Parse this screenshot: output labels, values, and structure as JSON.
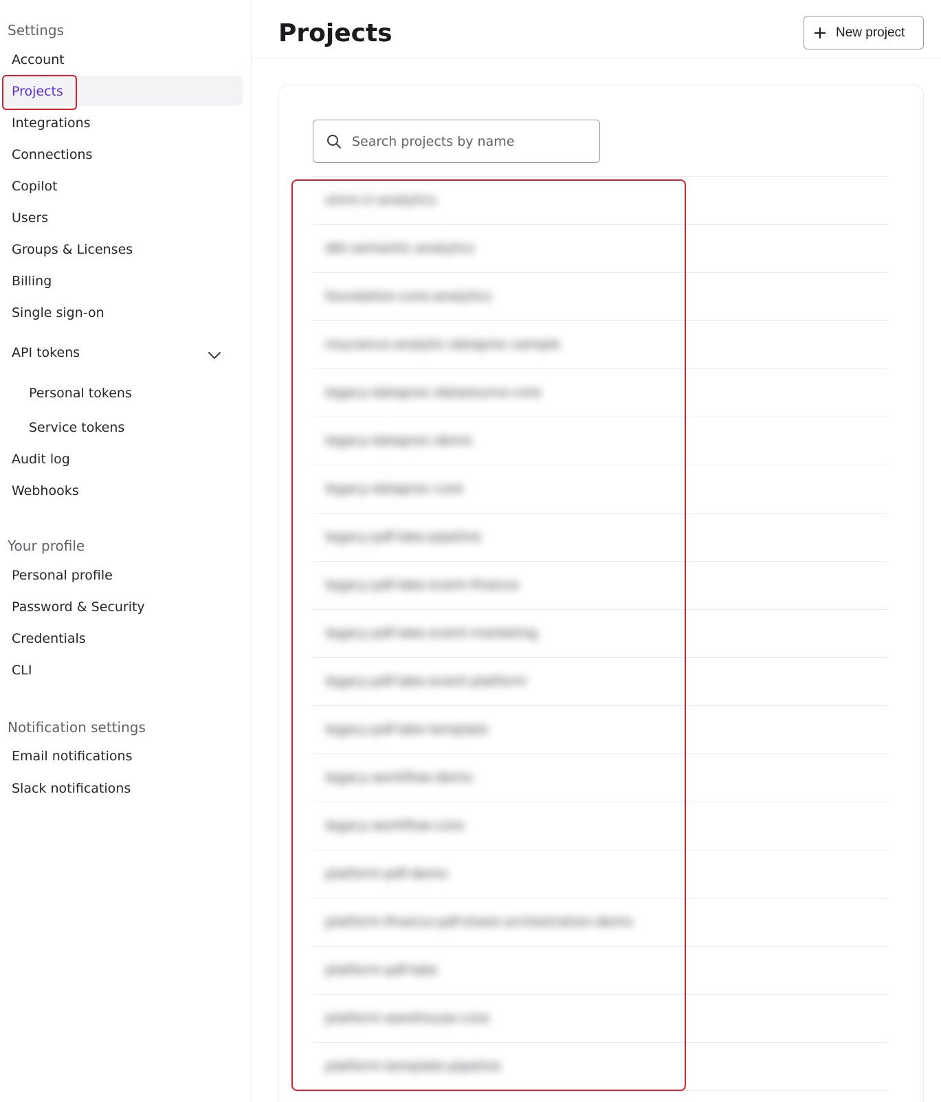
{
  "sidebar": {
    "settings_title": "Settings",
    "items": [
      {
        "label": "Account"
      },
      {
        "label": "Projects"
      },
      {
        "label": "Integrations"
      },
      {
        "label": "Connections"
      },
      {
        "label": "Copilot"
      },
      {
        "label": "Users"
      },
      {
        "label": "Groups & Licenses"
      },
      {
        "label": "Billing"
      },
      {
        "label": "Single sign-on"
      },
      {
        "label": "API tokens"
      },
      {
        "label": "Personal tokens"
      },
      {
        "label": "Service tokens"
      },
      {
        "label": "Audit log"
      },
      {
        "label": "Webhooks"
      }
    ],
    "profile_title": "Your profile",
    "profile_items": [
      {
        "label": "Personal profile"
      },
      {
        "label": "Password & Security"
      },
      {
        "label": "Credentials"
      },
      {
        "label": "CLI"
      }
    ],
    "notification_title": "Notification settings",
    "notification_items": [
      {
        "label": "Email notifications"
      },
      {
        "label": "Slack notifications"
      }
    ],
    "active_item": "Projects"
  },
  "header": {
    "title": "Projects",
    "new_button_label": "New project",
    "new_button_icon": "plus-icon"
  },
  "search": {
    "placeholder": "Search projects by name",
    "value": "",
    "icon": "search-icon"
  },
  "projects": [
    {
      "name": "omni-ci-analytics"
    },
    {
      "name": "dbt-semantic-analytics"
    },
    {
      "name": "foundation-core-analytics"
    },
    {
      "name": "insurance-analytic-dataproc-sample"
    },
    {
      "name": "legacy-dataproc-datasource-core"
    },
    {
      "name": "legacy-dataproc-demo"
    },
    {
      "name": "legacy-dataproc-core"
    },
    {
      "name": "legacy-pdf-lake-pipeline"
    },
    {
      "name": "legacy-pdf-lake-event-finance"
    },
    {
      "name": "legacy-pdf-lake-event-marketing"
    },
    {
      "name": "legacy-pdf-lake-event-platform"
    },
    {
      "name": "legacy-pdf-lake-template"
    },
    {
      "name": "legacy-workflow-demo"
    },
    {
      "name": "legacy-workflow-core"
    },
    {
      "name": "platform-pdf-demo"
    },
    {
      "name": "platform-finance-pdf-share-orchestration-demo"
    },
    {
      "name": "platform-pdf-lake"
    },
    {
      "name": "platform-warehouse-core"
    },
    {
      "name": "platform-template-pipeline"
    }
  ],
  "colors": {
    "accent": "#5b2de0",
    "highlight": "#e11d2a",
    "active_bg": "#f3f3f5"
  }
}
